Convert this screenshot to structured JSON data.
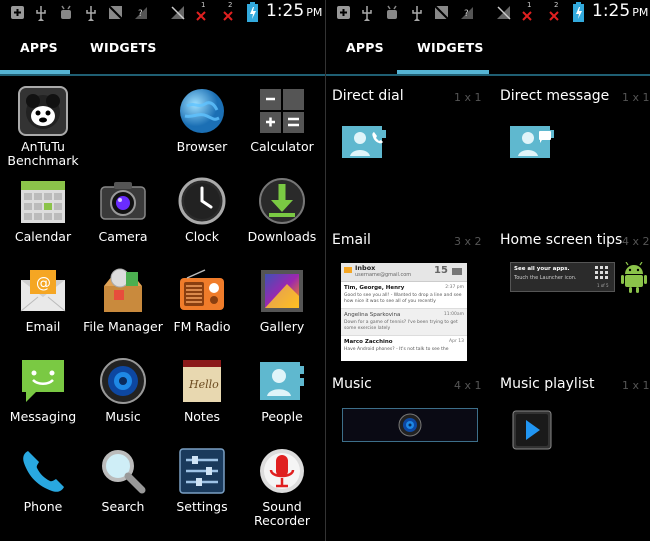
{
  "status_bar": {
    "time": "1:25",
    "ampm": "PM",
    "sup_1": "1",
    "sup_2": "2"
  },
  "tabs": {
    "apps": "APPS",
    "widgets": "WIDGETS"
  },
  "apps": [
    {
      "label": "AnTuTu Benchmark",
      "icon": "antutu-icon"
    },
    {
      "label": "Browser",
      "icon": "globe-icon"
    },
    {
      "label": "Calculator",
      "icon": "calculator-icon"
    },
    {
      "label": "Calendar",
      "icon": "calendar-icon"
    },
    {
      "label": "Camera",
      "icon": "camera-icon"
    },
    {
      "label": "Clock",
      "icon": "clock-icon"
    },
    {
      "label": "Downloads",
      "icon": "download-icon"
    },
    {
      "label": "Email",
      "icon": "email-icon"
    },
    {
      "label": "File Manager",
      "icon": "file-manager-icon"
    },
    {
      "label": "FM Radio",
      "icon": "radio-icon"
    },
    {
      "label": "Gallery",
      "icon": "gallery-icon"
    },
    {
      "label": "Messaging",
      "icon": "messaging-icon"
    },
    {
      "label": "Music",
      "icon": "music-icon"
    },
    {
      "label": "Notes",
      "icon": "notes-icon"
    },
    {
      "label": "People",
      "icon": "people-icon"
    },
    {
      "label": "Phone",
      "icon": "phone-icon"
    },
    {
      "label": "Search",
      "icon": "search-icon"
    },
    {
      "label": "Settings",
      "icon": "settings-icon"
    },
    {
      "label": "Sound Recorder",
      "icon": "microphone-icon"
    }
  ],
  "notes_icon_text": "Hello",
  "widgets": [
    {
      "title": "Direct dial",
      "size": "1 x 1"
    },
    {
      "title": "Direct message",
      "size": "1 x 1"
    },
    {
      "title": "Email",
      "size": "3 x 2"
    },
    {
      "title": "Home screen tips",
      "size": "4 x 2"
    },
    {
      "title": "Music",
      "size": "4 x 1"
    },
    {
      "title": "Music playlist",
      "size": "1 x 1"
    }
  ],
  "email_widget": {
    "header": "Inbox",
    "account": "username@gmail.com",
    "count": "15",
    "rows": [
      {
        "from": "Tim, George, Henry",
        "time": "2:37 pm",
        "text": "Good to see you all! - Wanted to drop a line and see how nice it was to see all of you recently"
      },
      {
        "from": "Angelina Sparkovina",
        "time": "11:00am",
        "text": "Down for a game of tennis? I've been trying to get some exercise lately"
      },
      {
        "from": "Marco Zacchino",
        "time": "Apr 13",
        "text": "Have Android phones? - It's not talk to see the"
      }
    ]
  },
  "tips_widget": {
    "line1": "See all your apps.",
    "line2": "Touch the Launcher icon.",
    "page": "1 of 5"
  }
}
